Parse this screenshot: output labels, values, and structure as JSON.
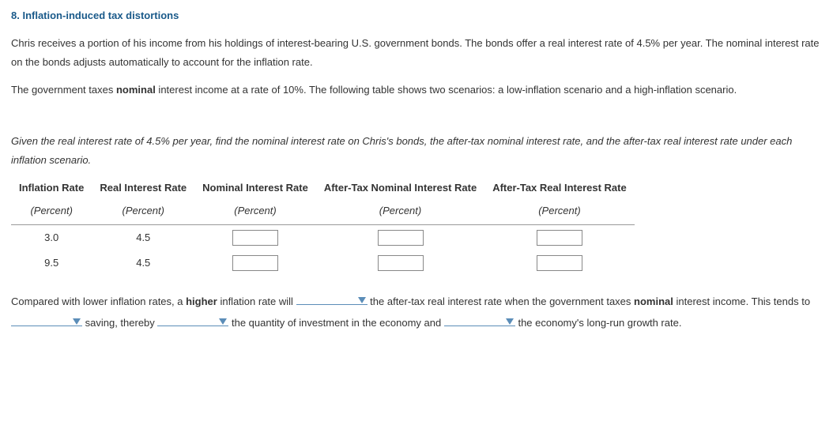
{
  "heading": "8. Inflation-induced tax distortions",
  "para1_a": "Chris receives a portion of his income from his holdings of interest-bearing U.S. government bonds. The bonds offer a real interest rate of 4.5% per year. The nominal interest rate on the bonds adjusts automatically to account for the inflation rate.",
  "para2_a": "The government taxes ",
  "para2_b": "nominal",
  "para2_c": " interest income at a rate of 10%. The following table shows two scenarios: a low-inflation scenario and a high-inflation scenario.",
  "instruction": "Given the real interest rate of 4.5% per year, find the nominal interest rate on Chris's bonds, the after-tax nominal interest rate, and the after-tax real interest rate under each inflation scenario.",
  "table": {
    "headers": {
      "col1": "Inflation Rate",
      "col2": "Real Interest Rate",
      "col3": "Nominal Interest Rate",
      "col4": "After-Tax Nominal Interest Rate",
      "col5": "After-Tax Real Interest Rate"
    },
    "subheader": "(Percent)",
    "rows": [
      {
        "inflation": "3.0",
        "real": "4.5"
      },
      {
        "inflation": "9.5",
        "real": "4.5"
      }
    ]
  },
  "fill": {
    "t1": "Compared with lower inflation rates, a ",
    "t1b": "higher",
    "t2": " inflation rate will ",
    "t3": " the after-tax real interest rate when the government taxes ",
    "t3b": "nominal",
    "t4": " interest income. This tends to ",
    "t5": " saving, thereby ",
    "t6": " the quantity of investment in the economy and ",
    "t7": " the economy's long-run growth rate."
  }
}
